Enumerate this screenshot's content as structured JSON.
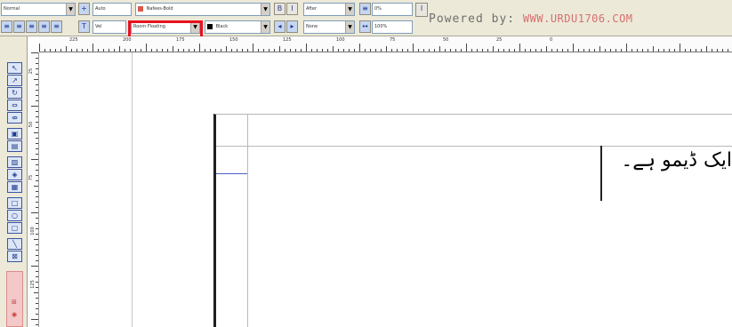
{
  "toolbar": {
    "style_combo": "Normal",
    "size_combo": "Auto",
    "font_combo": "Nafees-Bold",
    "blank_combo": "",
    "lang_combo": "After",
    "percent_combo": "0%",
    "size2_combo": "Vel",
    "kerning_combo": "Room Floating",
    "color_combo": "Black",
    "none_combo": "None",
    "scale_combo": "100%",
    "bold_label": "B",
    "italic_label": "I",
    "powered_prefix": "Powered by:",
    "powered_site": "WWW.URDU1706.COM"
  },
  "ruler": {
    "h_labels": [
      "225",
      "200",
      "175",
      "150",
      "125",
      "100",
      "75",
      "50",
      "25",
      "0"
    ],
    "v_labels": [
      "25",
      "50",
      "75",
      "100",
      "125"
    ]
  },
  "document": {
    "urdu_text": "یہ ایک ڈیمو ہے۔"
  },
  "palette": {
    "bottom_label": "Urdu"
  },
  "colors": {
    "highlight": "#e8121f",
    "toolbar_bg": "#ece9d8",
    "powered_site": "#d86e6e"
  }
}
